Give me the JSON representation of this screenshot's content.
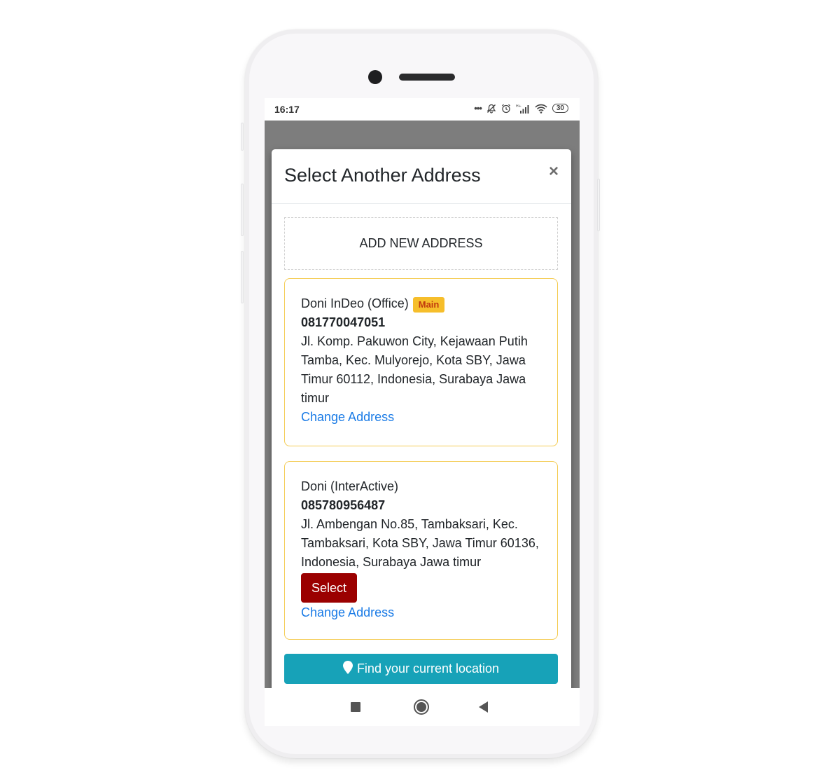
{
  "status_bar": {
    "time": "16:17",
    "icons": [
      "more-dots-icon",
      "notifications-off-icon",
      "alarm-icon",
      "signal-icon",
      "wifi-icon",
      "battery-icon"
    ],
    "battery_level": "30"
  },
  "modal": {
    "title": "Select Another Address",
    "close_label": "×",
    "add_new_label": "ADD NEW ADDRESS",
    "addresses": [
      {
        "name": "Doni InDeo (Office)",
        "badge": "Main",
        "phone": "081770047051",
        "address": "Jl. Komp. Pakuwon City, Kejawaan Putih Tamba, Kec. Mulyorejo, Kota SBY, Jawa Timur 60112, Indonesia, Surabaya Jawa timur",
        "change_label": "Change Address"
      },
      {
        "name": "Doni (InterActive)",
        "phone": "085780956487",
        "address": "Jl. Ambengan No.85, Tambaksari, Kec. Tambaksari, Kota SBY, Jawa Timur 60136, Indonesia, Surabaya Jawa timur",
        "select_label": "Select",
        "change_label": "Change Address"
      }
    ],
    "locate_label": "Find your current location"
  },
  "colors": {
    "card_border": "#f4cc55",
    "badge_bg": "#f6be2b",
    "badge_text": "#c0390e",
    "link": "#1a7be6",
    "select_button": "#9b0000",
    "locate_button": "#17a2b8",
    "backdrop": "#7d7d7d"
  },
  "nav_bar": {
    "buttons": [
      "recent-apps",
      "home",
      "back"
    ]
  }
}
